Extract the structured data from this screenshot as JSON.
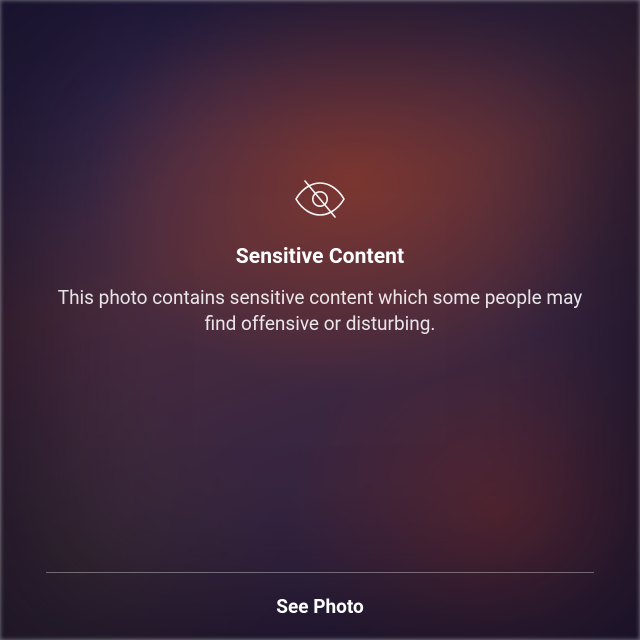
{
  "warning": {
    "title": "Sensitive Content",
    "description": "This photo contains sensitive content which some people may find offensive or disturbing.",
    "action_label": "See Photo"
  }
}
